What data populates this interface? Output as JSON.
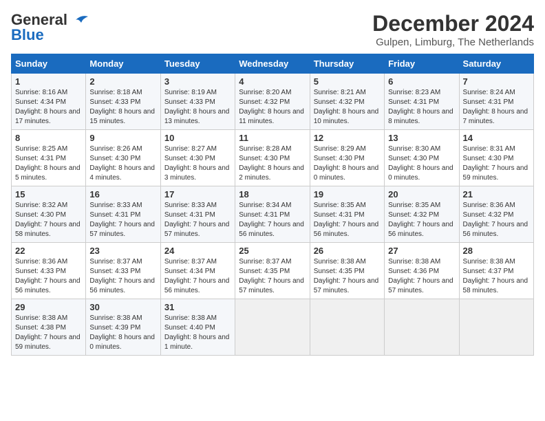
{
  "header": {
    "logo_general": "General",
    "logo_blue": "Blue",
    "month_title": "December 2024",
    "location": "Gulpen, Limburg, The Netherlands"
  },
  "weekdays": [
    "Sunday",
    "Monday",
    "Tuesday",
    "Wednesday",
    "Thursday",
    "Friday",
    "Saturday"
  ],
  "weeks": [
    [
      {
        "day": "1",
        "sunrise": "8:16 AM",
        "sunset": "4:34 PM",
        "daylight": "8 hours and 17 minutes."
      },
      {
        "day": "2",
        "sunrise": "8:18 AM",
        "sunset": "4:33 PM",
        "daylight": "8 hours and 15 minutes."
      },
      {
        "day": "3",
        "sunrise": "8:19 AM",
        "sunset": "4:33 PM",
        "daylight": "8 hours and 13 minutes."
      },
      {
        "day": "4",
        "sunrise": "8:20 AM",
        "sunset": "4:32 PM",
        "daylight": "8 hours and 11 minutes."
      },
      {
        "day": "5",
        "sunrise": "8:21 AM",
        "sunset": "4:32 PM",
        "daylight": "8 hours and 10 minutes."
      },
      {
        "day": "6",
        "sunrise": "8:23 AM",
        "sunset": "4:31 PM",
        "daylight": "8 hours and 8 minutes."
      },
      {
        "day": "7",
        "sunrise": "8:24 AM",
        "sunset": "4:31 PM",
        "daylight": "8 hours and 7 minutes."
      }
    ],
    [
      {
        "day": "8",
        "sunrise": "8:25 AM",
        "sunset": "4:31 PM",
        "daylight": "8 hours and 5 minutes."
      },
      {
        "day": "9",
        "sunrise": "8:26 AM",
        "sunset": "4:30 PM",
        "daylight": "8 hours and 4 minutes."
      },
      {
        "day": "10",
        "sunrise": "8:27 AM",
        "sunset": "4:30 PM",
        "daylight": "8 hours and 3 minutes."
      },
      {
        "day": "11",
        "sunrise": "8:28 AM",
        "sunset": "4:30 PM",
        "daylight": "8 hours and 2 minutes."
      },
      {
        "day": "12",
        "sunrise": "8:29 AM",
        "sunset": "4:30 PM",
        "daylight": "8 hours and 0 minutes."
      },
      {
        "day": "13",
        "sunrise": "8:30 AM",
        "sunset": "4:30 PM",
        "daylight": "8 hours and 0 minutes."
      },
      {
        "day": "14",
        "sunrise": "8:31 AM",
        "sunset": "4:30 PM",
        "daylight": "7 hours and 59 minutes."
      }
    ],
    [
      {
        "day": "15",
        "sunrise": "8:32 AM",
        "sunset": "4:30 PM",
        "daylight": "7 hours and 58 minutes."
      },
      {
        "day": "16",
        "sunrise": "8:33 AM",
        "sunset": "4:31 PM",
        "daylight": "7 hours and 57 minutes."
      },
      {
        "day": "17",
        "sunrise": "8:33 AM",
        "sunset": "4:31 PM",
        "daylight": "7 hours and 57 minutes."
      },
      {
        "day": "18",
        "sunrise": "8:34 AM",
        "sunset": "4:31 PM",
        "daylight": "7 hours and 56 minutes."
      },
      {
        "day": "19",
        "sunrise": "8:35 AM",
        "sunset": "4:31 PM",
        "daylight": "7 hours and 56 minutes."
      },
      {
        "day": "20",
        "sunrise": "8:35 AM",
        "sunset": "4:32 PM",
        "daylight": "7 hours and 56 minutes."
      },
      {
        "day": "21",
        "sunrise": "8:36 AM",
        "sunset": "4:32 PM",
        "daylight": "7 hours and 56 minutes."
      }
    ],
    [
      {
        "day": "22",
        "sunrise": "8:36 AM",
        "sunset": "4:33 PM",
        "daylight": "7 hours and 56 minutes."
      },
      {
        "day": "23",
        "sunrise": "8:37 AM",
        "sunset": "4:33 PM",
        "daylight": "7 hours and 56 minutes."
      },
      {
        "day": "24",
        "sunrise": "8:37 AM",
        "sunset": "4:34 PM",
        "daylight": "7 hours and 56 minutes."
      },
      {
        "day": "25",
        "sunrise": "8:37 AM",
        "sunset": "4:35 PM",
        "daylight": "7 hours and 57 minutes."
      },
      {
        "day": "26",
        "sunrise": "8:38 AM",
        "sunset": "4:35 PM",
        "daylight": "7 hours and 57 minutes."
      },
      {
        "day": "27",
        "sunrise": "8:38 AM",
        "sunset": "4:36 PM",
        "daylight": "7 hours and 57 minutes."
      },
      {
        "day": "28",
        "sunrise": "8:38 AM",
        "sunset": "4:37 PM",
        "daylight": "7 hours and 58 minutes."
      }
    ],
    [
      {
        "day": "29",
        "sunrise": "8:38 AM",
        "sunset": "4:38 PM",
        "daylight": "7 hours and 59 minutes."
      },
      {
        "day": "30",
        "sunrise": "8:38 AM",
        "sunset": "4:39 PM",
        "daylight": "8 hours and 0 minutes."
      },
      {
        "day": "31",
        "sunrise": "8:38 AM",
        "sunset": "4:40 PM",
        "daylight": "8 hours and 1 minute."
      },
      null,
      null,
      null,
      null
    ]
  ]
}
